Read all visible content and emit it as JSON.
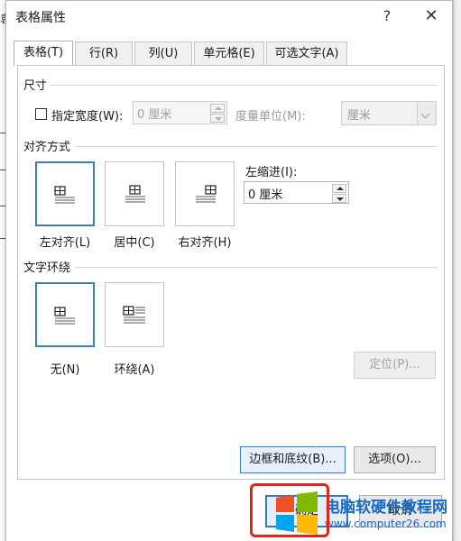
{
  "window": {
    "title": "表格属性",
    "help_label": "?",
    "close_label": "✕"
  },
  "background": {
    "fragment": "袁"
  },
  "tabs": [
    {
      "label": "表格(T)",
      "active": true
    },
    {
      "label": "行(R)",
      "active": false
    },
    {
      "label": "列(U)",
      "active": false
    },
    {
      "label": "单元格(E)",
      "active": false
    },
    {
      "label": "可选文字(A)",
      "active": false
    }
  ],
  "size_section": {
    "title": "尺寸",
    "preferred_width_label": "指定宽度(W):",
    "preferred_width_checked": false,
    "width_value": "0 厘米",
    "measure_in_label": "度量单位(M):",
    "measure_in_value": "厘米"
  },
  "alignment_section": {
    "title": "对齐方式",
    "options": [
      {
        "label": "左对齐(L)",
        "selected": true,
        "icon": "align-left-icon"
      },
      {
        "label": "居中(C)",
        "selected": false,
        "icon": "align-center-icon"
      },
      {
        "label": "右对齐(H)",
        "selected": false,
        "icon": "align-right-icon"
      }
    ],
    "indent_label": "左缩进(I):",
    "indent_value": "0 厘米"
  },
  "wrapping_section": {
    "title": "文字环绕",
    "options": [
      {
        "label": "无(N)",
        "selected": true,
        "icon": "wrap-none-icon"
      },
      {
        "label": "环绕(A)",
        "selected": false,
        "icon": "wrap-around-icon"
      }
    ],
    "positioning_label": "定位(P)..."
  },
  "buttons": {
    "borders_label": "边框和底纹(B)...",
    "options_label": "选项(O)...",
    "ok_label": "确定",
    "cancel_label": "取消"
  },
  "watermark": {
    "text": "电脑软硬件教程网",
    "url": "www.computer26.com",
    "logo": "windows-logo-icon"
  },
  "colors": {
    "accent_blue": "#3c7fb1",
    "highlight_red": "#e2231a",
    "watermark_blue": "#1569c7"
  }
}
